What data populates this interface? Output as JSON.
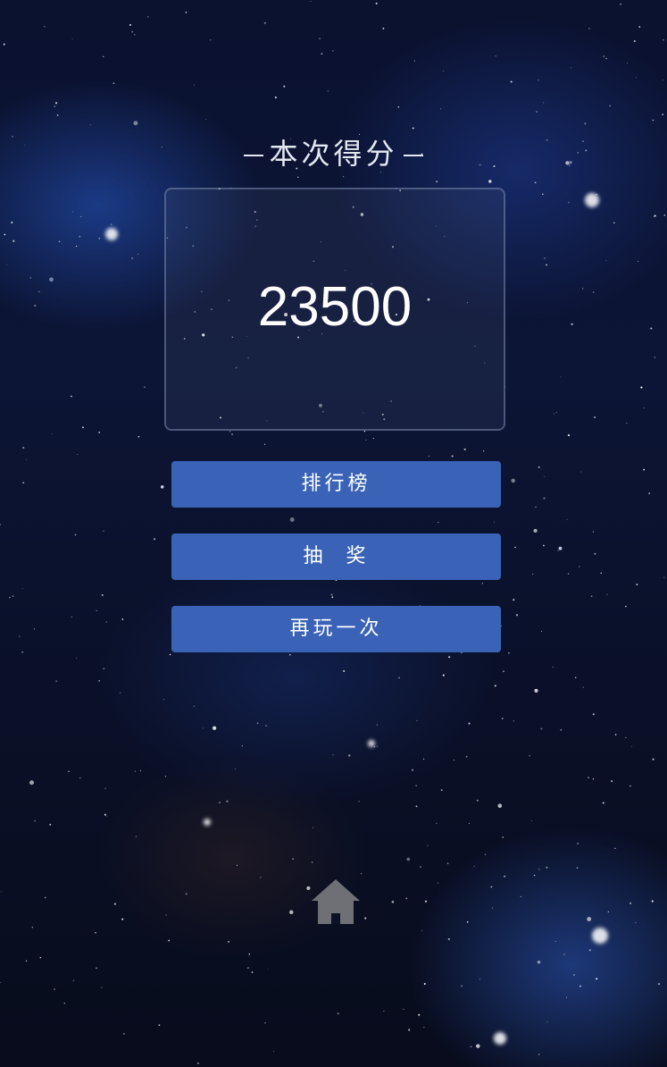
{
  "title": "本次得分",
  "score": "23500",
  "buttons": {
    "leaderboard": "排行榜",
    "lottery": "抽  奖",
    "play_again": "再玩一次"
  },
  "icons": {
    "home": "home-icon"
  },
  "colors": {
    "button": "#3a63b8",
    "text": "#ffffff",
    "home_icon": "#6f7075"
  }
}
